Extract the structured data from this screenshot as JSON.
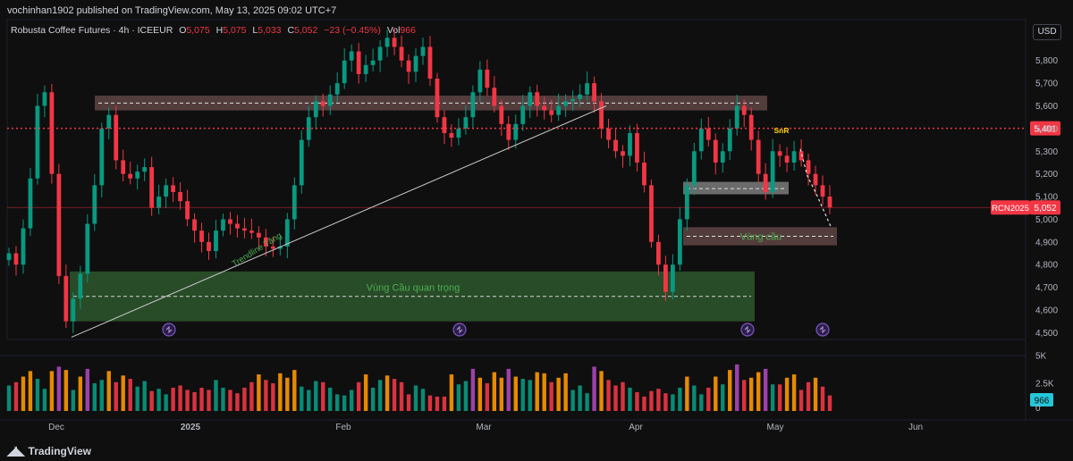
{
  "attribution": "vochinhan1902 published on TradingView.com, May 13, 2025 09:02 UTC+7",
  "legend": {
    "symbol": "Robusta Coffee Futures · 4h · ICEEUR",
    "open_label": "O",
    "open": "5,075",
    "high_label": "H",
    "high": "5,075",
    "low_label": "L",
    "low": "5,033",
    "close_label": "C",
    "close": "5,052",
    "change": "−23 (−0.45%)",
    "volume_label": "Vol",
    "volume": "966"
  },
  "currency_button": "USD",
  "footer": {
    "logo": "TradingView"
  },
  "colors": {
    "up": "#089981",
    "down": "#f23645",
    "background": "#0f0f0f",
    "resistance_zone": "#6b4c4c",
    "demand_zone": "#2e5a2e",
    "snr_label": "#ffd600",
    "zone_text": "#4caf50"
  },
  "chart_data": {
    "type": "candlestick",
    "symbol": "RCN2025",
    "interval": "4h",
    "y_ticks": [
      4500,
      4600,
      4700,
      4800,
      4900,
      5000,
      5100,
      5200,
      5300,
      5400,
      5500,
      5600,
      5700,
      5800
    ],
    "y_tick_labels": [
      "4,500",
      "4,600",
      "4,700",
      "4,800",
      "4,900",
      "5,000",
      "5,100",
      "5,200",
      "5,300",
      "5,500",
      "5,600",
      "5,700",
      "5,800"
    ],
    "ylim": [
      4470,
      5880
    ],
    "x_ticks": [
      "Dec",
      "2025",
      "Feb",
      "Mar",
      "Apr",
      "May",
      "Jun"
    ],
    "close_series": [
      4850,
      4800,
      4960,
      5180,
      5500,
      5560,
      5200,
      4750,
      4550,
      4650,
      4760,
      4980,
      5150,
      5400,
      5460,
      5260,
      5200,
      5180,
      5210,
      5230,
      5050,
      5100,
      5150,
      5120,
      5080,
      5000,
      4950,
      4900,
      4860,
      4950,
      5000,
      4980,
      4960,
      4950,
      4940,
      4920,
      4880,
      4870,
      4880,
      5000,
      5150,
      5350,
      5450,
      5520,
      5500,
      5550,
      5600,
      5700,
      5740,
      5640,
      5680,
      5700,
      5760,
      5800,
      5760,
      5700,
      5650,
      5720,
      5760,
      5620,
      5450,
      5380,
      5360,
      5400,
      5450,
      5560,
      5660,
      5580,
      5500,
      5420,
      5350,
      5420,
      5500,
      5560,
      5500,
      5480,
      5460,
      5500,
      5520,
      5530,
      5550,
      5600,
      5520,
      5400,
      5350,
      5300,
      5280,
      5380,
      5250,
      5150,
      4900,
      4800,
      4680,
      4800,
      5000,
      5150,
      5300,
      5400,
      5350,
      5250,
      5300,
      5400,
      5500,
      5460,
      5350,
      5200,
      5120,
      5300,
      5280,
      5250,
      5300,
      5260,
      5200,
      5150,
      5100,
      5052
    ],
    "current_price": {
      "label": "RCN2025",
      "value": "5,052"
    },
    "level_line": {
      "value": "5,401"
    },
    "volume": {
      "y_ticks": [
        "0",
        "2.5K",
        "5K"
      ],
      "current": "966",
      "values": [
        2300,
        2600,
        3100,
        3600,
        2900,
        2000,
        3600,
        4000,
        3700,
        1900,
        3100,
        3800,
        2500,
        2800,
        3600,
        2600,
        3200,
        2900,
        2200,
        2700,
        1800,
        2000,
        1500,
        2100,
        2300,
        1900,
        1700,
        2100,
        1900,
        2800,
        2100,
        1900,
        1600,
        2100,
        2600,
        3300,
        2800,
        2500,
        3400,
        3000,
        3700,
        2200,
        1900,
        2700,
        2600,
        2100,
        1500,
        1400,
        1900,
        2600,
        3300,
        2100,
        2800,
        3200,
        2900,
        2600,
        1500,
        2300,
        2000,
        1400,
        1300,
        1300,
        3300,
        2400,
        2700,
        3800,
        3000,
        2500,
        3500,
        3000,
        3800,
        3100,
        2900,
        2800,
        3500,
        3400,
        2600,
        3000,
        3400,
        1900,
        2300,
        1600,
        4000,
        3600,
        2800,
        2300,
        2600,
        2100,
        1700,
        1300,
        1800,
        2000,
        1600,
        1500,
        2100,
        3100,
        2300,
        1500,
        2100,
        3100,
        2400,
        3700,
        4200,
        2800,
        3000,
        3500,
        3800,
        2400,
        2400,
        3000,
        3300,
        1900,
        2600,
        3000,
        2200,
        1400
      ]
    },
    "annotations": {
      "trendline_label": "Trendline Tăng",
      "zone_main_label": "Vùng Cầu quan trọng",
      "zone_small_label": "Vùng cầu",
      "snr_label": "SnR"
    }
  }
}
